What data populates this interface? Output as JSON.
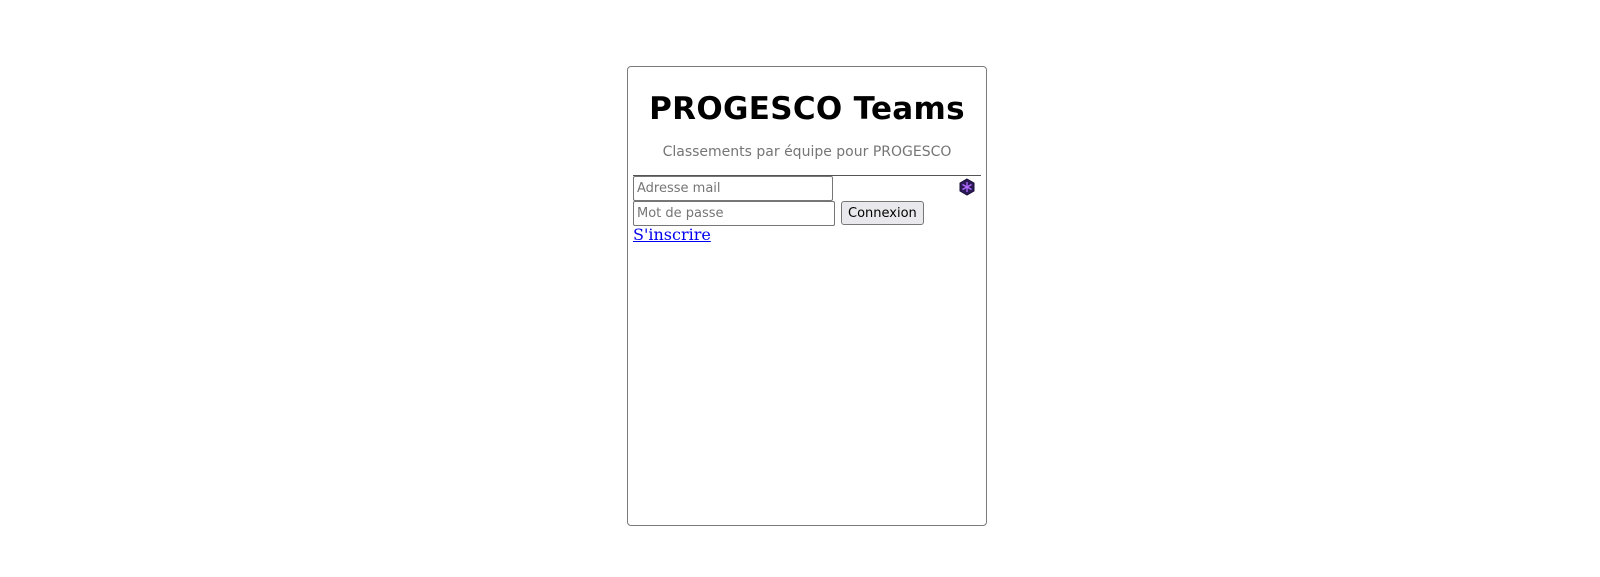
{
  "header": {
    "title": "PROGESCO Teams",
    "subtitle": "Classements par équipe pour PROGESCO"
  },
  "login_form": {
    "email_placeholder": "Adresse mail",
    "email_value": "",
    "password_placeholder": "Mot de passe",
    "password_value": "",
    "submit_label": "Connexion"
  },
  "links": {
    "signup_label": "S'inscrire"
  },
  "icons": {
    "extension": "hexagon-snowflake-icon"
  },
  "colors": {
    "link": "#0000ee",
    "extension_icon_fill": "#2b1a57",
    "extension_icon_accent": "#b36cff"
  }
}
